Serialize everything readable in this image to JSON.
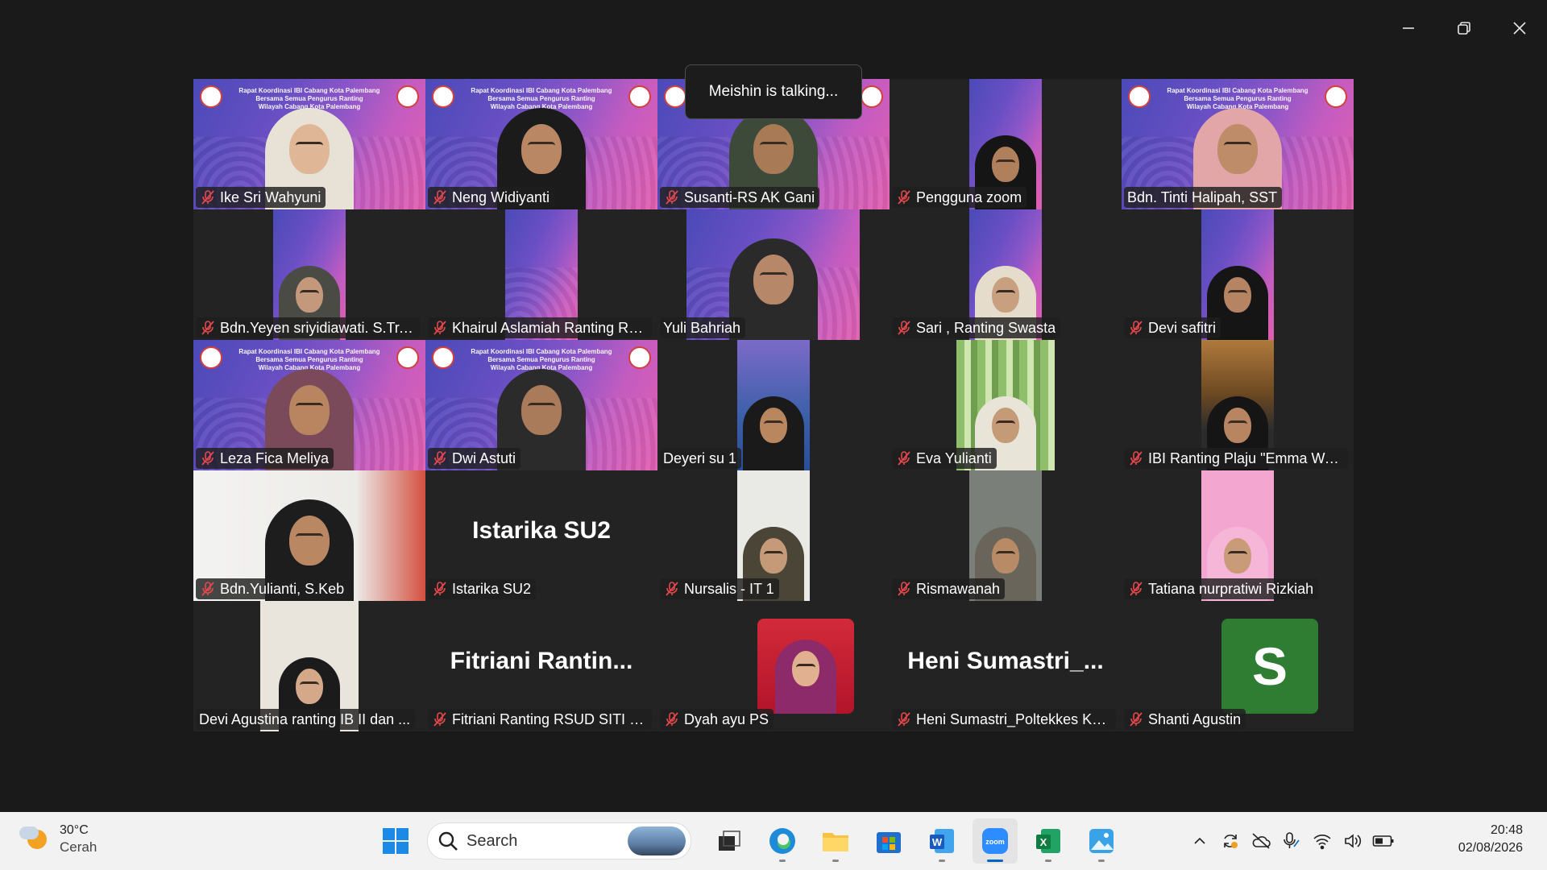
{
  "window": {
    "controls": [
      "minimize",
      "restore",
      "close"
    ]
  },
  "talking_indicator": "Meishin is talking...",
  "banner": {
    "line1": "Rapat Koordinasi IBI Cabang Kota Palembang",
    "line2": "Bersama Semua Pengurus Ranting",
    "line3": "Wilayah Cabang Kota Palembang"
  },
  "participants": [
    {
      "name": "Ike Sri Wahyuni",
      "muted": true
    },
    {
      "name": "Neng Widiyanti",
      "muted": true
    },
    {
      "name": "Susanti-RS AK Gani",
      "muted": true
    },
    {
      "name": "Pengguna zoom",
      "muted": true
    },
    {
      "name": "Bdn. Tinti Halipah, SST",
      "muted": false
    },
    {
      "name": "Bdn.Yeyen sriyidiawati. S.Tr.K...",
      "muted": true
    },
    {
      "name": "Khairul Aslamiah Ranting RS...",
      "muted": true
    },
    {
      "name": "Yuli Bahriah",
      "muted": false
    },
    {
      "name": "Sari , Ranting Swasta",
      "muted": true
    },
    {
      "name": "Devi safitri",
      "muted": true
    },
    {
      "name": "Leza Fica Meliya",
      "muted": true
    },
    {
      "name": "Dwi Astuti",
      "muted": true
    },
    {
      "name": "Deyeri su 1",
      "muted": false
    },
    {
      "name": "Eva Yulianti",
      "muted": true
    },
    {
      "name": "IBI Ranting Plaju \"Emma Wa...",
      "muted": true
    },
    {
      "name": "Bdn.Yulianti, S.Keb",
      "muted": true
    },
    {
      "name": "Istarika SU2",
      "muted": true,
      "display": "Istarika SU2"
    },
    {
      "name": "Nursalis - IT 1",
      "muted": true
    },
    {
      "name": "Rismawanah",
      "muted": true
    },
    {
      "name": "Tatiana nurpratiwi Rizkiah",
      "muted": true
    },
    {
      "name": "Devi Agustina ranting IB II dan ...",
      "muted": false
    },
    {
      "name": "Fitriani  Ranting RSUD SITI F...",
      "muted": true,
      "display": "Fitriani  Rantin..."
    },
    {
      "name": "Dyah ayu PS",
      "muted": true
    },
    {
      "name": "Heni Sumastri_Poltekkes Ke...",
      "muted": true,
      "display": "Heni  Sumastri_..."
    },
    {
      "name": "Shanti Agustin",
      "muted": true,
      "avatar_letter": "S"
    }
  ],
  "taskbar": {
    "weather": {
      "temp": "30°C",
      "condition": "Cerah",
      "icon": "sun-cloud-icon"
    },
    "search_placeholder": "Search",
    "apps": [
      "start",
      "task-view",
      "edge",
      "file-explorer",
      "microsoft-store",
      "word",
      "zoom",
      "excel",
      "photos"
    ],
    "active_app": "zoom",
    "tray_icons": [
      "chevron-up",
      "sync",
      "cloud-off",
      "microphone",
      "wifi",
      "volume",
      "battery"
    ],
    "clock": {
      "time": "20:48",
      "date": "02/08/2026"
    }
  },
  "colors": {
    "accent": "#0067c0",
    "muted_mic": "#e5484d",
    "banner_left": "#4b4ab8",
    "banner_right": "#e25fb0",
    "avatar_green": "#2e7d32"
  }
}
